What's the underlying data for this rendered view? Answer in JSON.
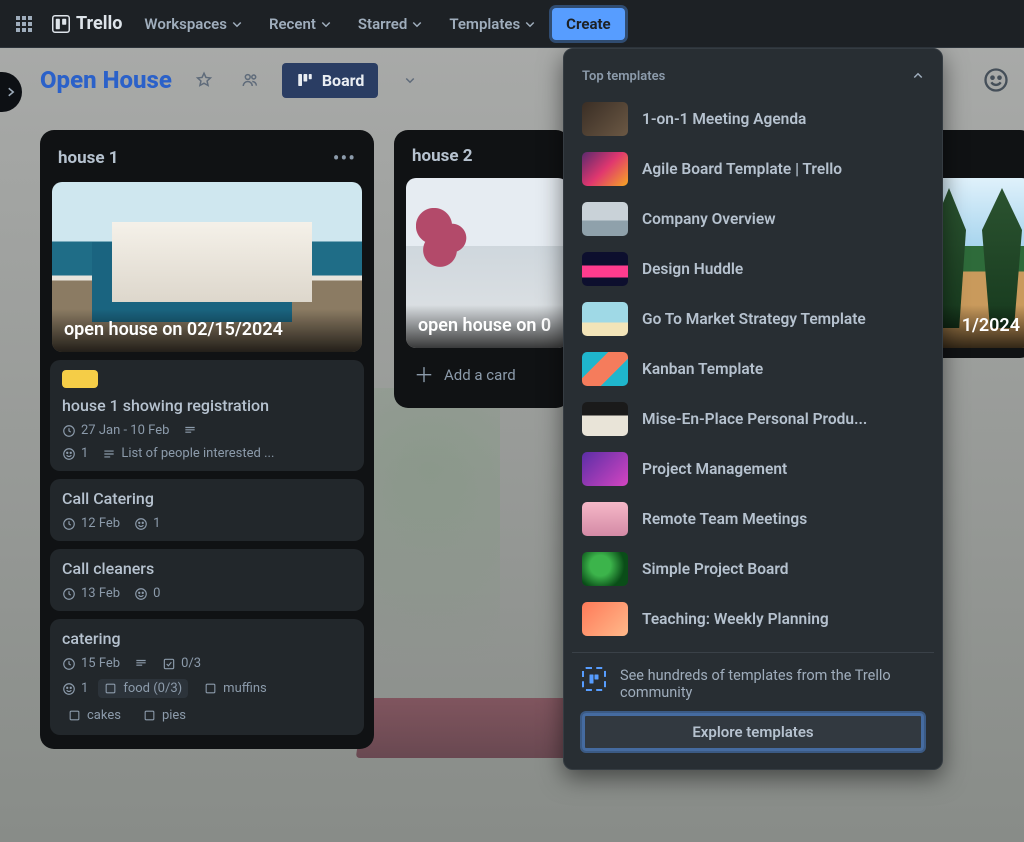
{
  "nav": {
    "brand": "Trello",
    "items": [
      "Workspaces",
      "Recent",
      "Starred",
      "Templates"
    ],
    "create": "Create"
  },
  "board": {
    "title": "Open House",
    "view_label": "Board"
  },
  "lists": [
    {
      "title": "house 1",
      "image_caption": "open house on 02/15/2024",
      "cards": [
        {
          "title": "house 1 showing registration",
          "date": "27 Jan - 10 Feb",
          "reactions": "1",
          "desc_tease": "List of people interested ..."
        },
        {
          "title": "Call Catering",
          "date": "12 Feb",
          "reactions": "1"
        },
        {
          "title": "Call cleaners",
          "date": "13 Feb",
          "reactions": "0"
        },
        {
          "title": "catering",
          "date": "15 Feb",
          "checklist": "0/3",
          "reactions": "1",
          "chips": [
            "food (0/3)",
            "muffins",
            "cakes",
            "pies"
          ]
        }
      ]
    },
    {
      "title": "house 2",
      "image_caption": "open house on 0",
      "add_label": "Add a card"
    },
    {
      "image_caption_suffix": "1/2024"
    }
  ],
  "popover": {
    "title": "Top templates",
    "templates": [
      "1-on-1 Meeting Agenda",
      "Agile Board Template | Trello",
      "Company Overview",
      "Design Huddle",
      "Go To Market Strategy Template",
      "Kanban Template",
      "Mise-En-Place Personal Produ...",
      "Project Management",
      "Remote Team Meetings",
      "Simple Project Board",
      "Teaching: Weekly Planning"
    ],
    "footer_text": "See hundreds of templates from the Trello community",
    "explore": "Explore templates"
  }
}
